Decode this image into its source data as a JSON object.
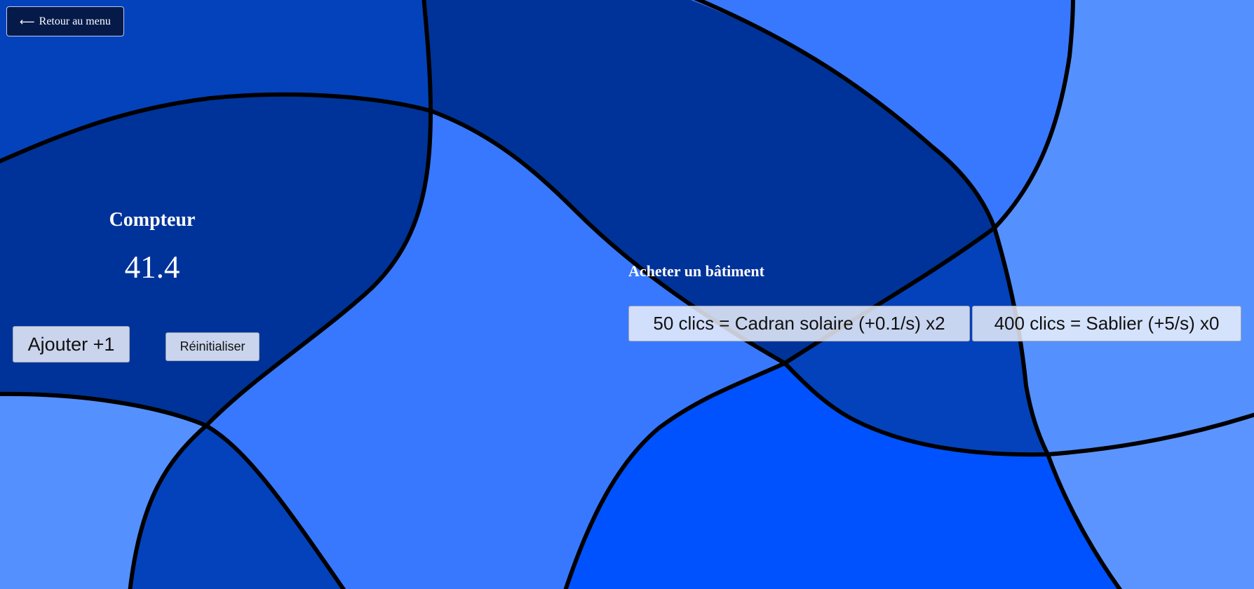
{
  "nav": {
    "back_icon": "arrow-left-icon",
    "back_icon_glyph": "⟵",
    "back_label": "Retour au menu"
  },
  "counter": {
    "title": "Compteur",
    "value": "41.4",
    "add_label": "Ajouter +1",
    "reset_label": "Réinitialiser"
  },
  "shop": {
    "title": "Acheter un bâtiment",
    "buildings": [
      {
        "label": "50 clics = Cadran solaire (+0.1/s) x2"
      },
      {
        "label": "400 clics = Sablier (+5/s) x0"
      }
    ]
  },
  "colors": {
    "background_mid": "#3878ff",
    "background_dark": "#003399",
    "background_medium": "#0442bc",
    "background_light": "#5590ff",
    "background_bright": "#0052ff",
    "curve_stroke": "#000000",
    "back_button": "#061a4a"
  }
}
